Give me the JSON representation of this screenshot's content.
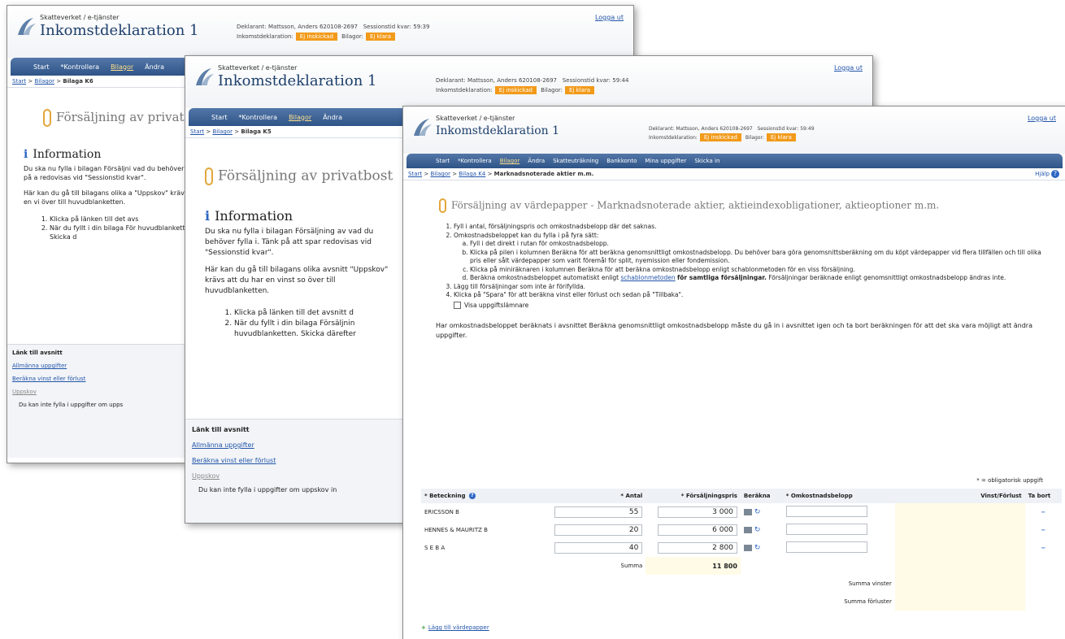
{
  "common": {
    "org": "Skatteverket / e-tjänster",
    "app_title": "Inkomstdeklaration 1",
    "declarant_label": "Deklarant:",
    "declarant": "Mattsson, Anders 620108-2697",
    "session_label": "Sessionstid kvar:",
    "tax_decl_label": "Inkomstdeklaration:",
    "tax_decl_status": "Ej inskickad",
    "attachments_label": "Bilagor:",
    "attachments_status": "Ej klara",
    "logout": "Logga ut",
    "nav": [
      "Start",
      "*Kontrollera",
      "Bilagor",
      "Ändra",
      "Skatteuträkning",
      "Bankkonto",
      "Mina uppgifter",
      "Skicka in"
    ]
  },
  "win1": {
    "session_time": "59:39",
    "breadcrumb": [
      "Start",
      "Bilagor",
      "Bilaga K6"
    ],
    "page_title": "Försäljning av privat",
    "info_title": "Information",
    "para1": "Du ska nu fylla i bilagan Försäljni vad du behöver fylla i. Tänk på a redovisas vid \"Sessionstid kvar\".",
    "para2": "Här kan du gå till bilagans olika a \"Uppskov\" krävs att du har en vi över till huvudblanketten.",
    "steps": [
      "Klicka på länken till det avs",
      "När du fyllt i din bilaga För huvudblanketten. Skicka d"
    ],
    "links_header": "Länk till avsnitt",
    "links": [
      "Allmänna uppgifter",
      "Beräkna vinst eller förlust",
      "Uppskov"
    ],
    "note": "Du kan inte fylla i uppgifter om upps"
  },
  "win2": {
    "session_time": "59:44",
    "breadcrumb": [
      "Start",
      "Bilagor",
      "Bilaga K5"
    ],
    "page_title": "Försäljning av privatbost",
    "info_title": "Information",
    "para1": "Du ska nu fylla i bilagan Försäljning av vad du behöver fylla i. Tänk på att spar redovisas vid \"Sessionstid kvar\".",
    "para2": "Här kan du gå till bilagans olika avsnitt \"Uppskov\" krävs att du har en vinst so över till huvudblanketten.",
    "steps": [
      "Klicka på länken till det avsnitt d",
      "När du fyllt i din bilaga Försäljnin huvudblanketten. Skicka därefter"
    ],
    "links_header": "Länk till avsnitt",
    "links": [
      "Allmänna uppgifter",
      "Beräkna vinst eller förlust",
      "Uppskov"
    ],
    "note": "Du kan inte fylla i uppgifter om uppskov in"
  },
  "win3": {
    "session_time": "59:49",
    "breadcrumb": [
      "Start",
      "Bilagor",
      "Bilaga K4",
      "Marknadsnoterade aktier m.m."
    ],
    "help": "Hjälp",
    "page_title": "Försäljning av värdepapper - Marknadsnoterade aktier, aktieindexobligationer, aktieoptioner m.m.",
    "step1": "Fyll i antal, försäljningspris och omkostnadsbelopp där det saknas.",
    "step2": "Omkostnadsbeloppet kan du fylla i på fyra sätt:",
    "sub_a": "Fyll i det direkt i rutan för omkostnadsbelopp.",
    "sub_b": "Klicka på pilen i kolumnen Beräkna för att beräkna genomsnittligt omkostnadsbelopp. Du behöver bara göra genomsnittsberäkning om du köpt värdepapper vid flera tillfällen och till olika pris eller sålt värdepapper som varit föremål för split, nyemission eller fondemission.",
    "sub_c": "Klicka på miniräknaren i kolumnen Beräkna för att beräkna omkostnadsbelopp enligt schablonmetoden för en viss försäljning.",
    "sub_d_pre": "Beräkna omkostnadsbeloppet automatiskt enligt",
    "sub_d_link": "schablonmetoden",
    "sub_d_bold": "för samtliga försäljningar.",
    "sub_d_post": "Försäljningar beräknade enligt genomsnittligt omkostnadsbelopp ändras inte.",
    "step3": "Lägg till försäljningar som inte är förifyllda.",
    "step4": "Klicka på \"Spara\" för att beräkna vinst eller förlust och sedan på \"Tillbaka\".",
    "checkbox_label": "Visa uppgiftslämnare",
    "note": "Har omkostnadsbeloppet beräknats i avsnittet Beräkna genomsnittligt omkostnadsbelopp måste du gå in i avsnittet igen och ta bort beräkningen för att det ska vara möjligt att ändra uppgifter.",
    "mandatory": "* = obligatorisk uppgift",
    "columns": [
      "* Beteckning",
      "* Antal",
      "* Försäljningspris",
      "Beräkna",
      "* Omkostnadsbelopp",
      "Vinst/Förlust",
      "Ta bort"
    ],
    "rows": [
      {
        "name": "ERICSSON B",
        "antal": "55",
        "pris": "3 000"
      },
      {
        "name": "HENNES & MAURITZ B",
        "antal": "20",
        "pris": "6 000"
      },
      {
        "name": "S E B A",
        "antal": "40",
        "pris": "2 800"
      }
    ],
    "sum_label": "Summa",
    "sum_value": "11 800",
    "sum_gains": "Summa vinster",
    "sum_losses": "Summa förluster",
    "add_link": "Lägg till värdepapper",
    "colors": {
      "nav": "#3a5f93",
      "accent": "#f29a1a",
      "link": "#2255aa"
    }
  }
}
